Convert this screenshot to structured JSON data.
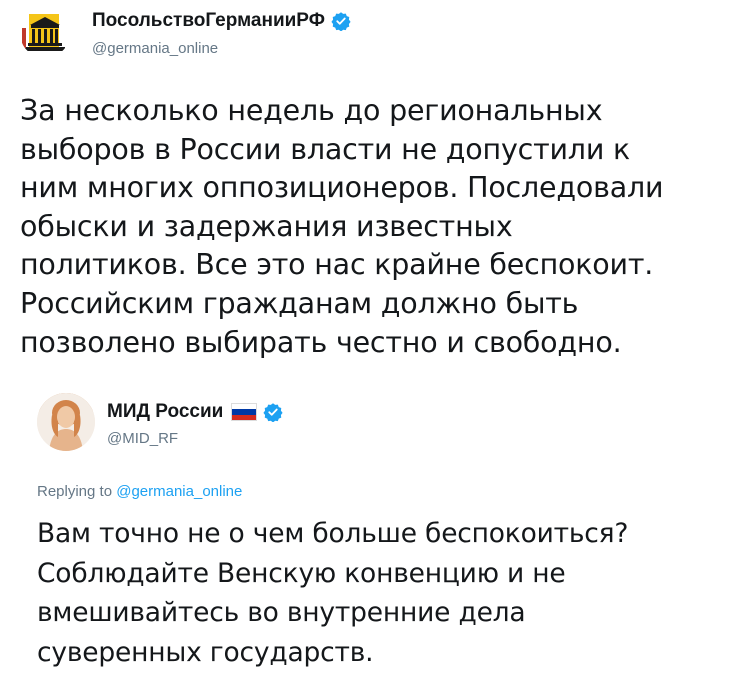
{
  "tweet": {
    "author_name": "ПосольствоГерманииРФ",
    "handle": "@germania_online",
    "verified": true,
    "avatar_icon": "embassy-building-logo",
    "text": "За несколько недель до региональных\nвыборов в России власти не допустили к\nним многих оппозиционеров. Последовали\nобыски и задержания известных\nполитиков. Все это нас крайне беспокоит.\nРоссийским гражданам должно быть\nпозволено выбирать честно и свободно."
  },
  "reply": {
    "author_name": "МИД России",
    "handle": "@MID_RF",
    "verified": true,
    "flag_icon": "russian-flag-icon",
    "flag_colors": [
      "#ffffff",
      "#0039a6",
      "#d52b1e"
    ],
    "replying_prefix": "Replying to ",
    "replying_to": "@germania_online",
    "text": "Вам точно не о чем больше беспокоиться?\nСоблюдайте Венскую конвенцию и не\nвмешивайтесь во внутренние дела\nсуверенных государств."
  },
  "colors": {
    "verified_blue": "#1da1f2",
    "secondary_text": "#657786",
    "embassy_yellow": "#f5c518",
    "embassy_dark": "#1a1a1a"
  }
}
